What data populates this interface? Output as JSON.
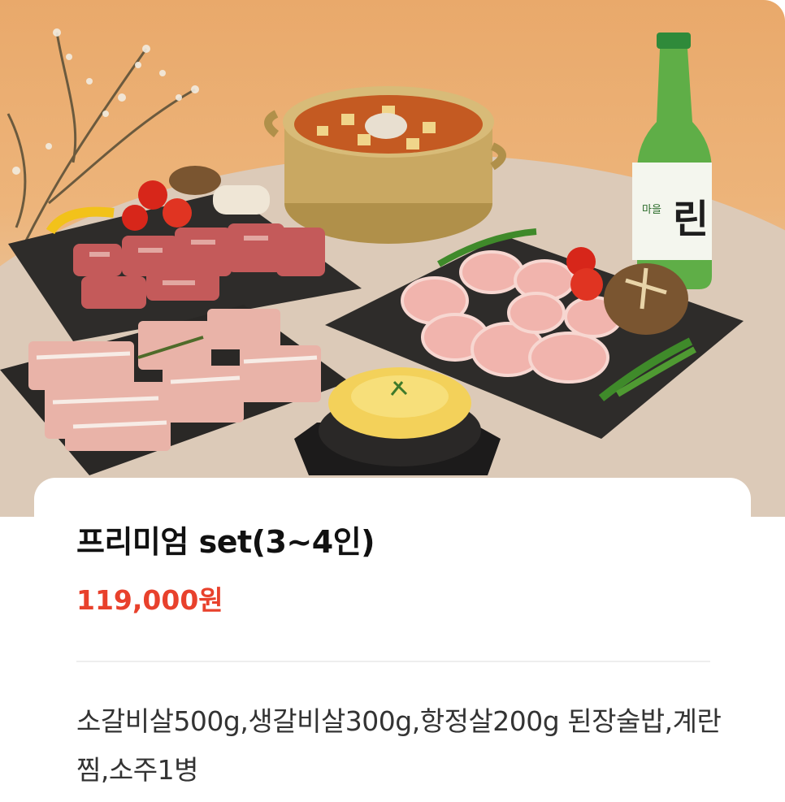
{
  "product": {
    "image_alt": "프리미엄 set 상차림",
    "bottle_label": "린",
    "bottle_sublabel": "마을",
    "title": "프리미엄 set(3~4인)",
    "price": "119,000원",
    "description": "소갈비살500g,생갈비살300g,항정살200g 된장술밥,계란찜,소주1병",
    "accent_color": "#e8412c"
  }
}
